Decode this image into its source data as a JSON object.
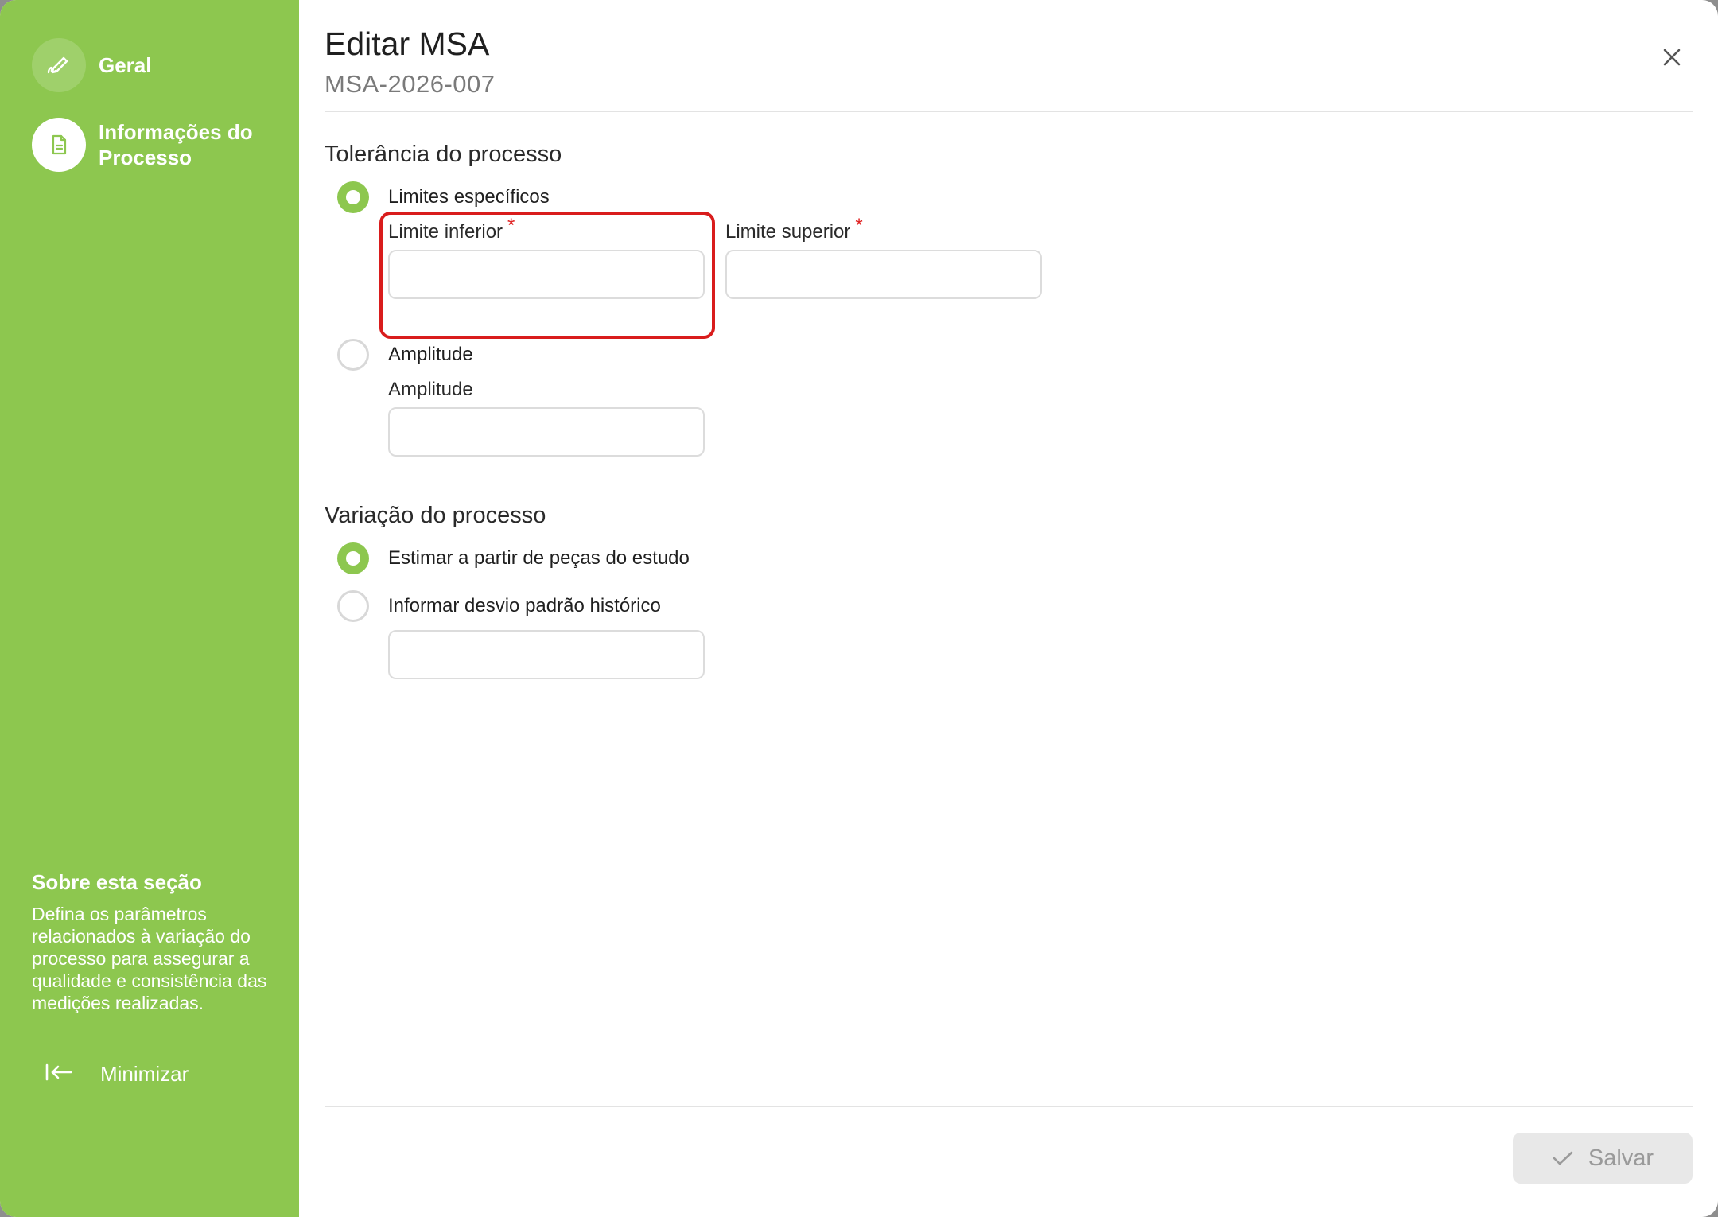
{
  "dialog": {
    "title": "Editar MSA",
    "subtitle": "MSA-2026-007"
  },
  "sidebar": {
    "items": [
      {
        "label": "Geral",
        "icon": "pencil-signature-icon"
      },
      {
        "label": "Informações do Processo",
        "icon": "document-icon"
      }
    ],
    "about_title": "Sobre esta seção",
    "about_text": "Defina os parâmetros relacionados à variação do processo para assegurar a qualidade e consistência das medições realizadas.",
    "minimize_label": "Minimizar"
  },
  "tolerance": {
    "title": "Tolerância do processo",
    "option_limits": "Limites específicos",
    "lower_label": "Limite inferior",
    "upper_label": "Limite superior",
    "required_mark": "*",
    "lower_value": "",
    "upper_value": "",
    "option_amplitude": "Amplitude",
    "amplitude_label": "Amplitude",
    "amplitude_value": "",
    "selected": "Limites específicos"
  },
  "variation": {
    "title": "Variação do processo",
    "option_estimate": "Estimar a partir de peças do estudo",
    "option_historic": "Informar desvio padrão histórico",
    "historic_value": "",
    "selected": "Estimar a partir de peças do estudo"
  },
  "footer": {
    "save_label": "Salvar"
  },
  "colors": {
    "accent": "#8dc74f",
    "highlight": "#d91c1c",
    "required": "#e02424",
    "disabled_bg": "#e8e8e8"
  }
}
